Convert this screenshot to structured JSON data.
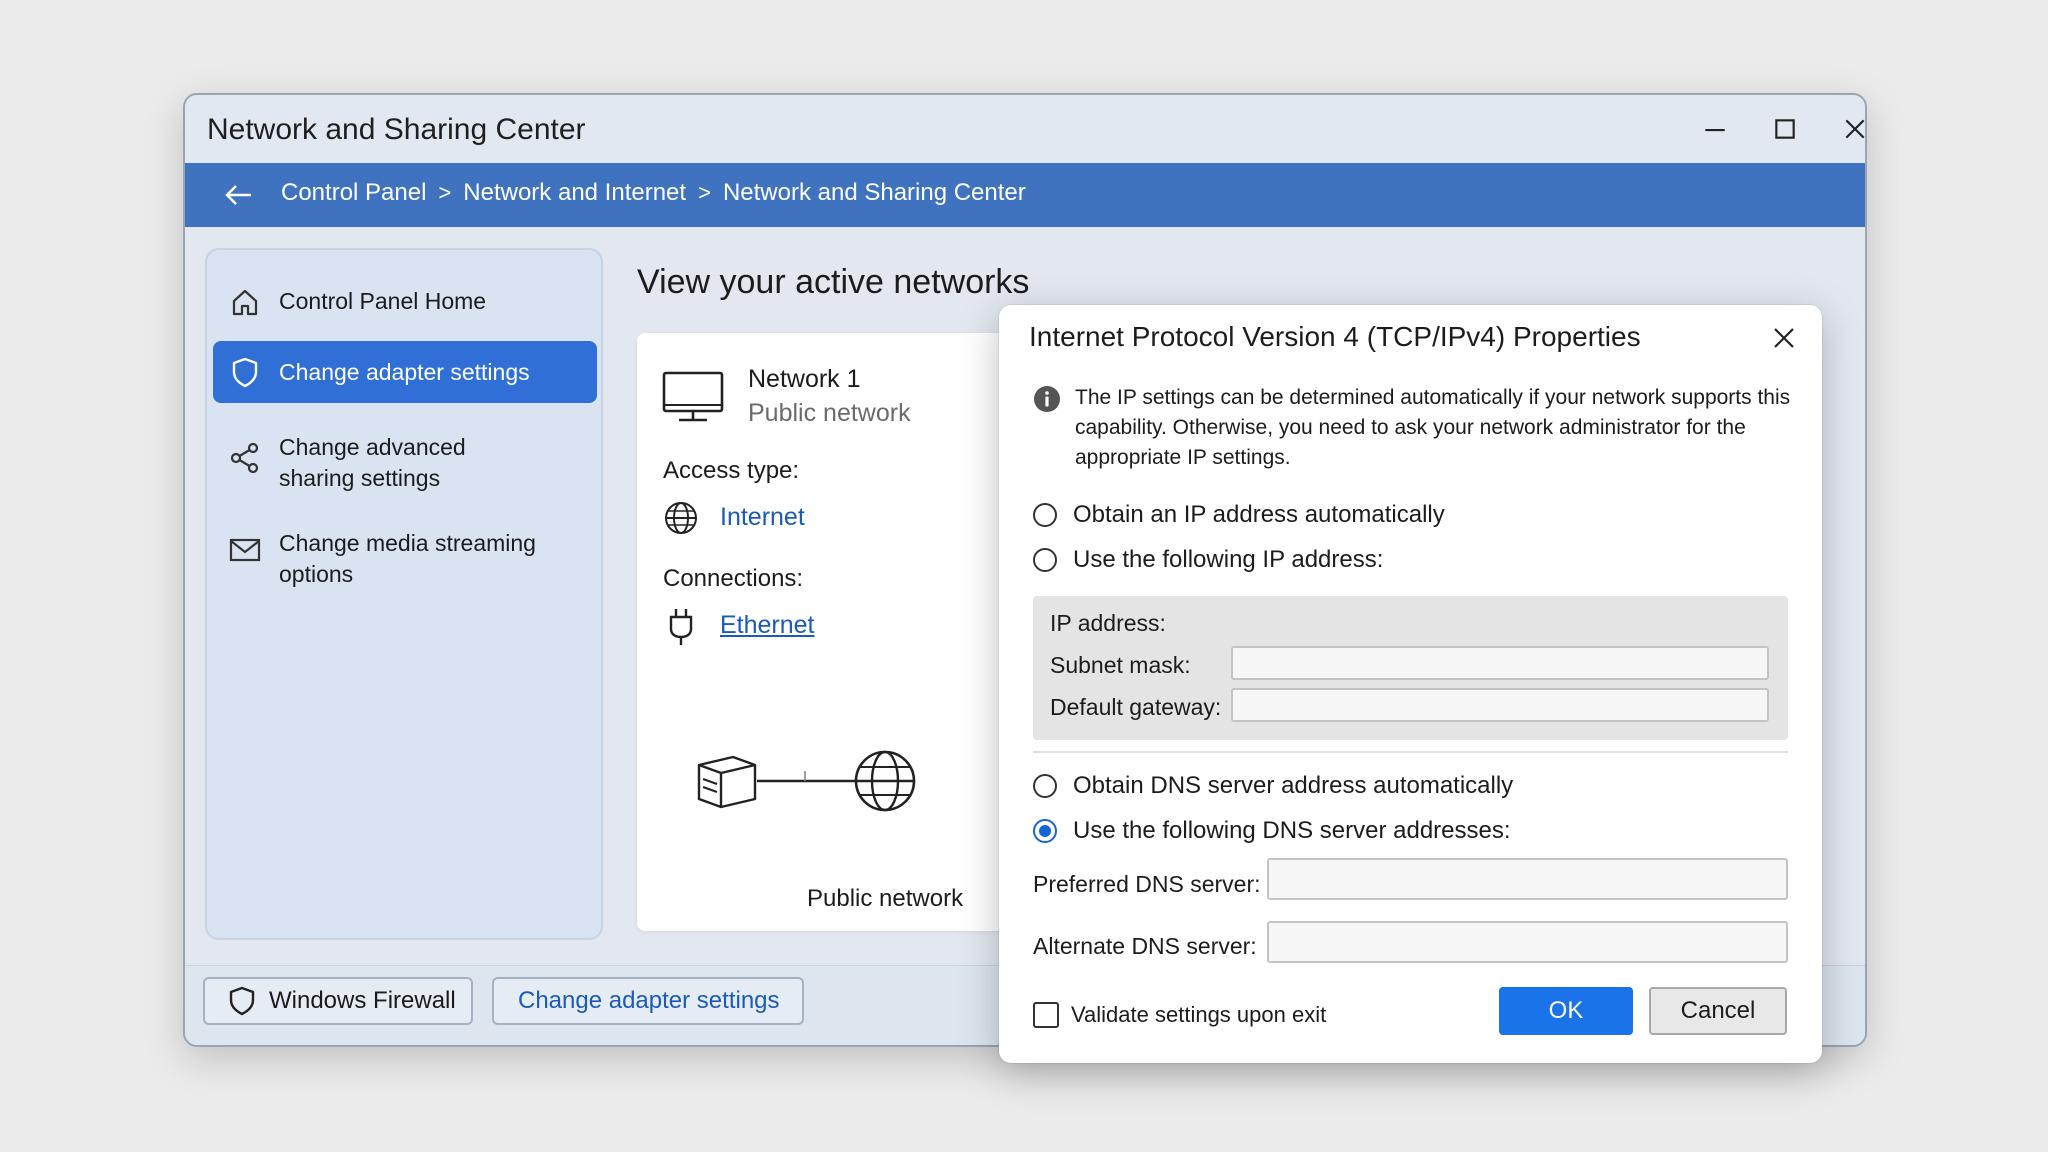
{
  "window": {
    "title": "Network and Sharing Center"
  },
  "breadcrumb": [
    "Control Panel",
    "Network and Internet",
    "Network and Sharing Center"
  ],
  "breadcrumb_sep": ">",
  "sidebar": {
    "items": [
      {
        "label": "Control Panel Home",
        "icon": "home-icon"
      },
      {
        "label": "Change adapter settings",
        "icon": "shield-icon",
        "active": true
      },
      {
        "label": "Change advanced sharing settings",
        "icon": "share-icon"
      },
      {
        "label": "Change media streaming options",
        "icon": "mail-icon"
      }
    ]
  },
  "main": {
    "heading": "View your active networks",
    "network": {
      "name": "Network 1",
      "type": "Public network",
      "access_label": "Access type:",
      "access_value": "Internet",
      "connections_label": "Connections:",
      "connection_value": "Ethernet",
      "diagram_label": "Public network"
    }
  },
  "bottom": {
    "firewall_label": "Windows Firewall",
    "adapter_label": "Change adapter settings"
  },
  "dialog": {
    "title": "Internet Protocol Version 4 (TCP/IPv4) Properties",
    "info": "The IP settings can be determined automatically if your network supports this capability. Otherwise, you need to ask your network administrator for the appropriate IP settings.",
    "ip_auto_label": "Obtain an IP address automatically",
    "ip_manual_label": "Use the following IP address:",
    "ip_address_label": "IP address:",
    "subnet_label": "Subnet mask:",
    "gateway_label": "Default gateway:",
    "dns_auto_label": "Obtain DNS server address automatically",
    "dns_manual_label": "Use the following DNS server addresses:",
    "dns_manual_selected": true,
    "preferred_dns_label": "Preferred DNS server:",
    "alternate_dns_label": "Alternate DNS server:",
    "validate_label": "Validate settings upon exit",
    "ok_label": "OK",
    "cancel_label": "Cancel"
  },
  "colors": {
    "accent": "#2f6fd6",
    "address_bar": "#3f73bf",
    "link": "#1a5bb8"
  }
}
